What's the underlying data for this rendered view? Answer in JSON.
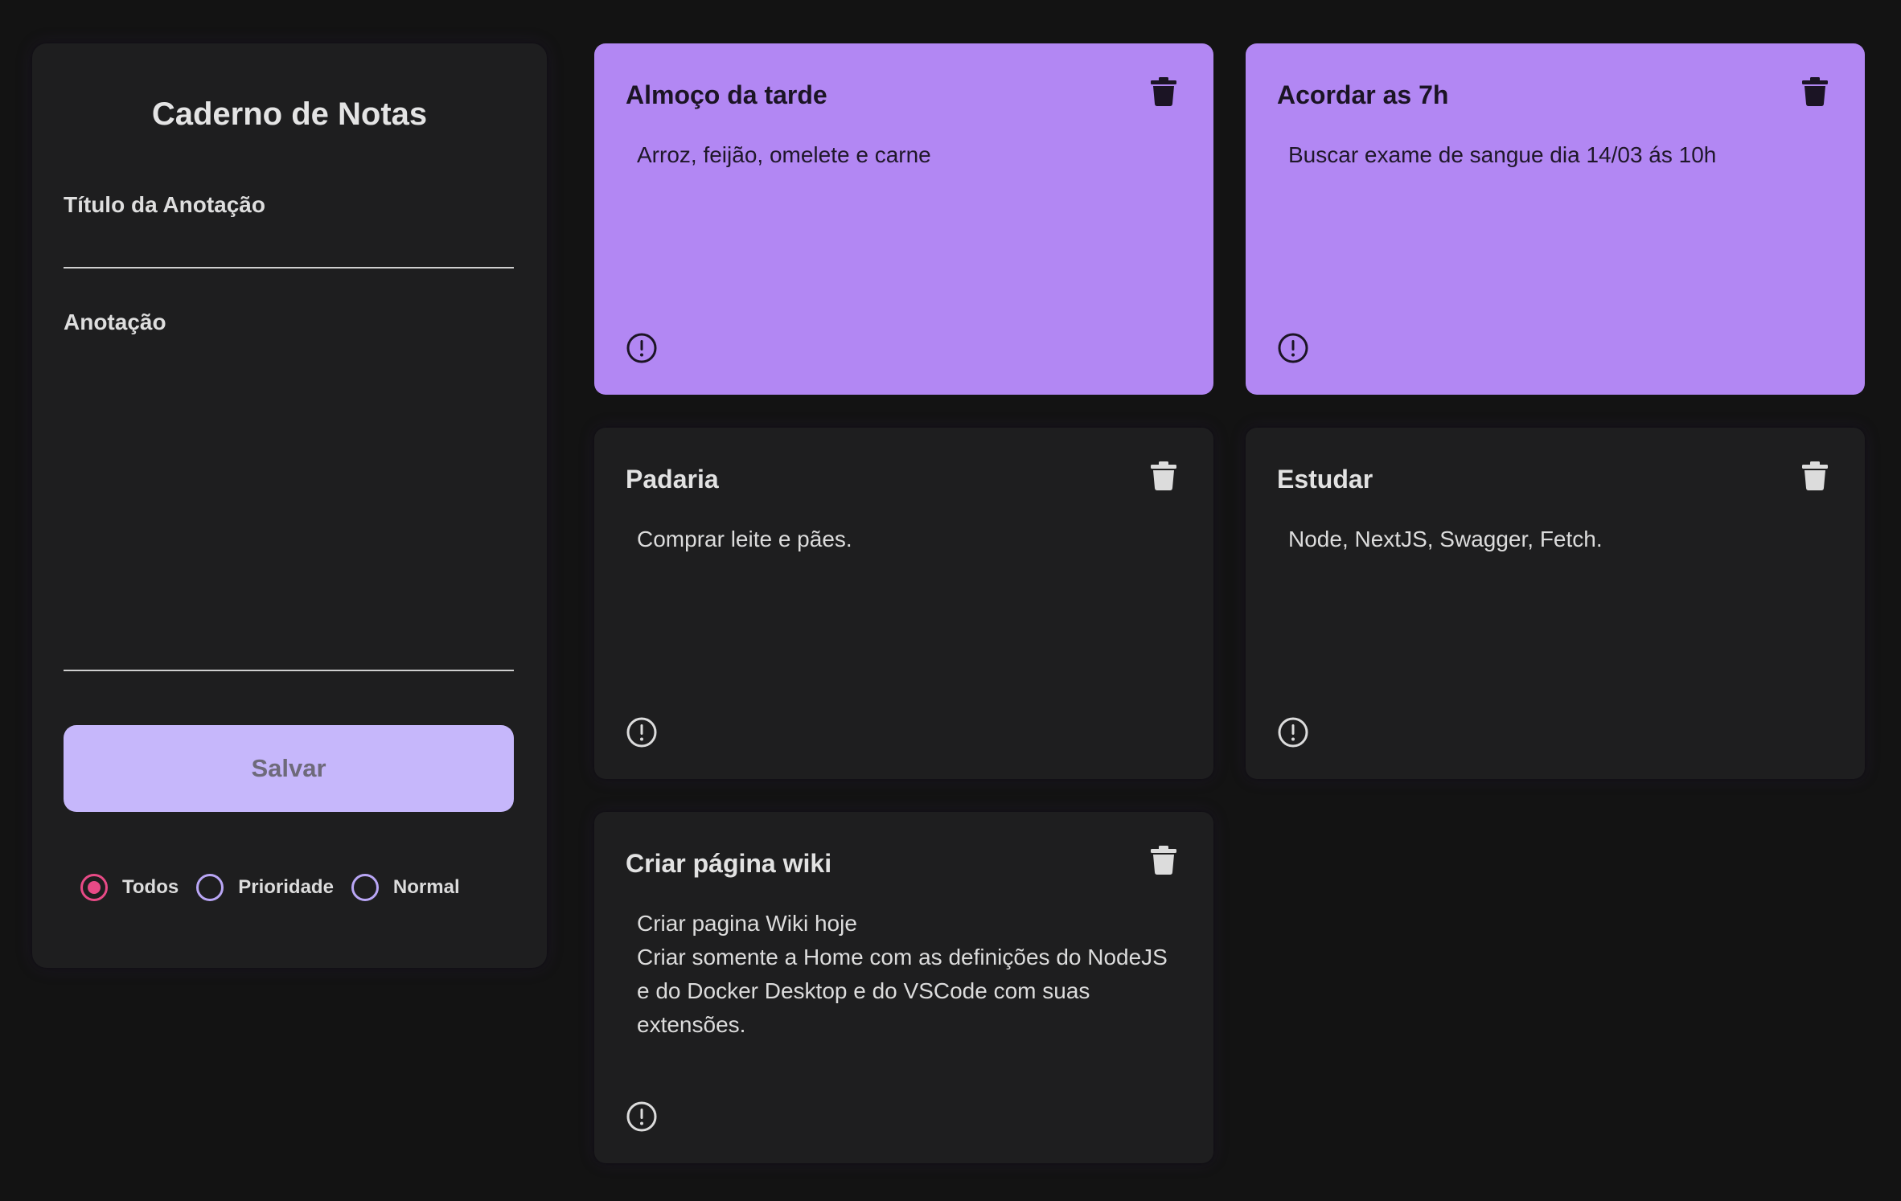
{
  "sidebar": {
    "title": "Caderno de Notas",
    "title_field_label": "Título da Anotação",
    "title_field_value": "",
    "note_field_label": "Anotação",
    "note_field_value": "",
    "save_label": "Salvar",
    "filters": [
      {
        "label": "Todos",
        "checked": true
      },
      {
        "label": "Prioridade",
        "checked": false
      },
      {
        "label": "Normal",
        "checked": false
      }
    ]
  },
  "colors": {
    "background": "#131313",
    "panel": "#1e1e1f",
    "priority_card": "#b287f3",
    "save_button": "#c6b7fb",
    "radio_checked": "#e84a86",
    "radio_unchecked": "#b9a6f5"
  },
  "notes": [
    {
      "title": "Almoço da tarde",
      "body": "Arroz, feijão, omelete e carne",
      "priority": true,
      "icons": [
        "trash-icon",
        "alert-circle-icon"
      ]
    },
    {
      "title": "Acordar as 7h",
      "body": "Buscar exame de sangue dia 14/03 ás 10h",
      "priority": true,
      "icons": [
        "trash-icon",
        "alert-circle-icon"
      ]
    },
    {
      "title": "Padaria",
      "body": "Comprar leite e pães.",
      "priority": false,
      "icons": [
        "trash-icon",
        "alert-circle-icon"
      ]
    },
    {
      "title": "Estudar",
      "body": "Node, NextJS, Swagger, Fetch.",
      "priority": false,
      "icons": [
        "trash-icon",
        "alert-circle-icon"
      ]
    },
    {
      "title": "Criar página wiki",
      "body": "Criar pagina Wiki hoje\nCriar somente a Home com as definições do NodeJS e do Docker Desktop e do VSCode com suas extensões.",
      "priority": false,
      "icons": [
        "trash-icon",
        "alert-circle-icon"
      ]
    }
  ]
}
